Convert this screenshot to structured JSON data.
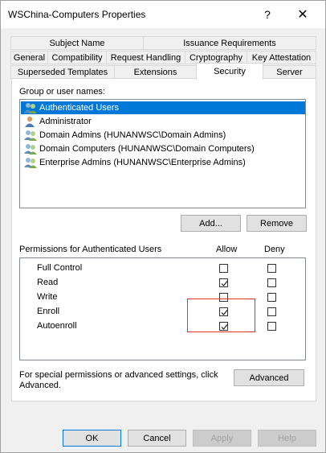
{
  "window": {
    "title": "WSChina-Computers Properties",
    "help_glyph": "?",
    "close_glyph": "✕"
  },
  "tabs": {
    "row1": [
      {
        "label": "Subject Name"
      },
      {
        "label": "Issuance Requirements"
      }
    ],
    "row2": [
      {
        "label": "General"
      },
      {
        "label": "Compatibility"
      },
      {
        "label": "Request Handling"
      },
      {
        "label": "Cryptography"
      },
      {
        "label": "Key Attestation"
      }
    ],
    "row3": [
      {
        "label": "Superseded Templates"
      },
      {
        "label": "Extensions"
      },
      {
        "label": "Security"
      },
      {
        "label": "Server"
      }
    ],
    "active": "Security"
  },
  "security": {
    "group_label": "Group or user names:",
    "principals": [
      {
        "name": "Authenticated Users",
        "icon": "group-users-icon",
        "selected": true
      },
      {
        "name": "Administrator",
        "icon": "user-icon",
        "selected": false
      },
      {
        "name": "Domain Admins (HUNANWSC\\Domain Admins)",
        "icon": "group-users-icon",
        "selected": false
      },
      {
        "name": "Domain Computers (HUNANWSC\\Domain Computers)",
        "icon": "group-users-icon",
        "selected": false
      },
      {
        "name": "Enterprise Admins (HUNANWSC\\Enterprise Admins)",
        "icon": "group-users-icon",
        "selected": false
      }
    ],
    "add_label": "Add...",
    "remove_label": "Remove",
    "permissions_label": "Permissions for Authenticated Users",
    "allow_header": "Allow",
    "deny_header": "Deny",
    "permissions": [
      {
        "name": "Full Control",
        "allow": false,
        "deny": false
      },
      {
        "name": "Read",
        "allow": true,
        "deny": false
      },
      {
        "name": "Write",
        "allow": false,
        "deny": false
      },
      {
        "name": "Enroll",
        "allow": true,
        "deny": false
      },
      {
        "name": "Autoenroll",
        "allow": true,
        "deny": false
      }
    ],
    "advanced_text_line1": "For special permissions or advanced settings, click",
    "advanced_text_line2": "Advanced.",
    "advanced_label": "Advanced"
  },
  "footer": {
    "ok_label": "OK",
    "cancel_label": "Cancel",
    "apply_label": "Apply",
    "help_label": "Help"
  },
  "colors": {
    "selection": "#0078d7",
    "highlight_box": "#e03030"
  }
}
